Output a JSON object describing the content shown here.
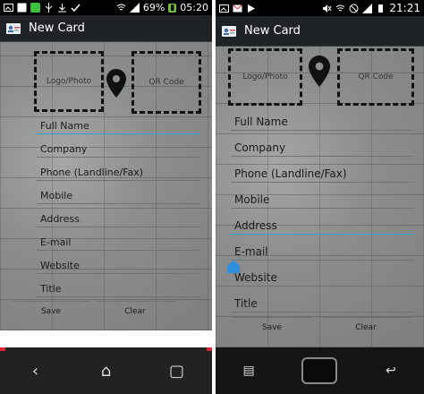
{
  "left": {
    "status": {
      "battery": "69%",
      "time": "05:20"
    },
    "title": "New Card",
    "logo_label": "Logo/Photo",
    "qr_label": "QR Code",
    "fields": [
      "Full Name",
      "Company",
      "Phone (Landline/Fax)",
      "Mobile",
      "Address",
      "E-mail",
      "Website",
      "Title"
    ],
    "save": "Save",
    "clear": "Clear",
    "nav": {
      "back": "‹",
      "home": "⌂",
      "recent": "▢"
    }
  },
  "right": {
    "status": {
      "time": "21:21"
    },
    "title": "New Card",
    "logo_label": "Logo/Photo",
    "qr_label": "QR Code",
    "fields": [
      "Full Name",
      "Company",
      "Phone (Landline/Fax)",
      "Mobile",
      "Address",
      "E-mail",
      "Website",
      "Title"
    ],
    "save": "Save",
    "clear": "Clear",
    "nav": {
      "menu": "▤",
      "back": "↩"
    }
  },
  "colors": {
    "accent": "#33a3dc",
    "battery": "#6fbf3a"
  }
}
